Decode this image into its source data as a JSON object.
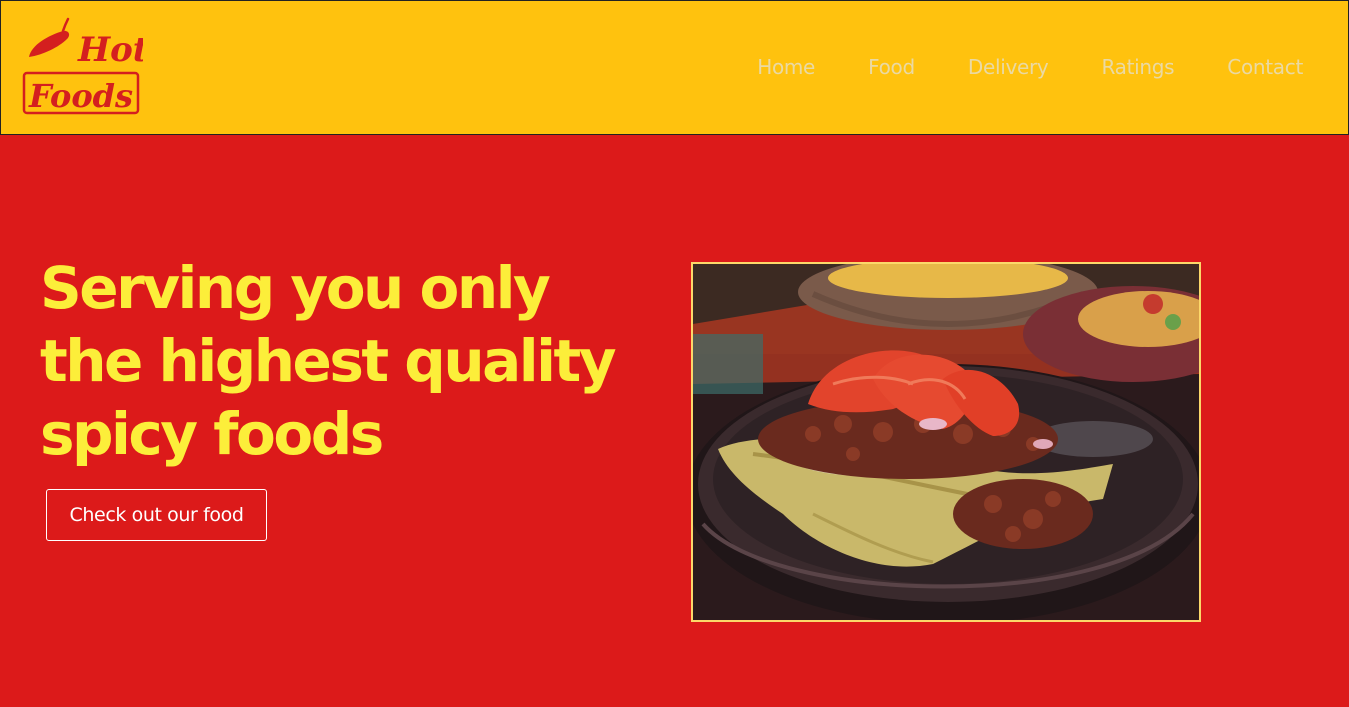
{
  "brand": {
    "logo_line1": "Hot",
    "logo_line2": "Foods"
  },
  "nav": [
    {
      "label": "Home"
    },
    {
      "label": "Food"
    },
    {
      "label": "Delivery"
    },
    {
      "label": "Ratings"
    },
    {
      "label": "Contact"
    }
  ],
  "hero": {
    "headline": "Serving you only the highest quality spicy foods",
    "cta_label": "Check out our food"
  },
  "colors": {
    "header_bg": "#ffc20e",
    "hero_bg": "#dc1a1a",
    "headline": "#fcee3a",
    "nav_text": "#ead9a3",
    "logo_red": "#d41f1f"
  },
  "icons": {
    "logo": "chili-pepper-icon"
  }
}
